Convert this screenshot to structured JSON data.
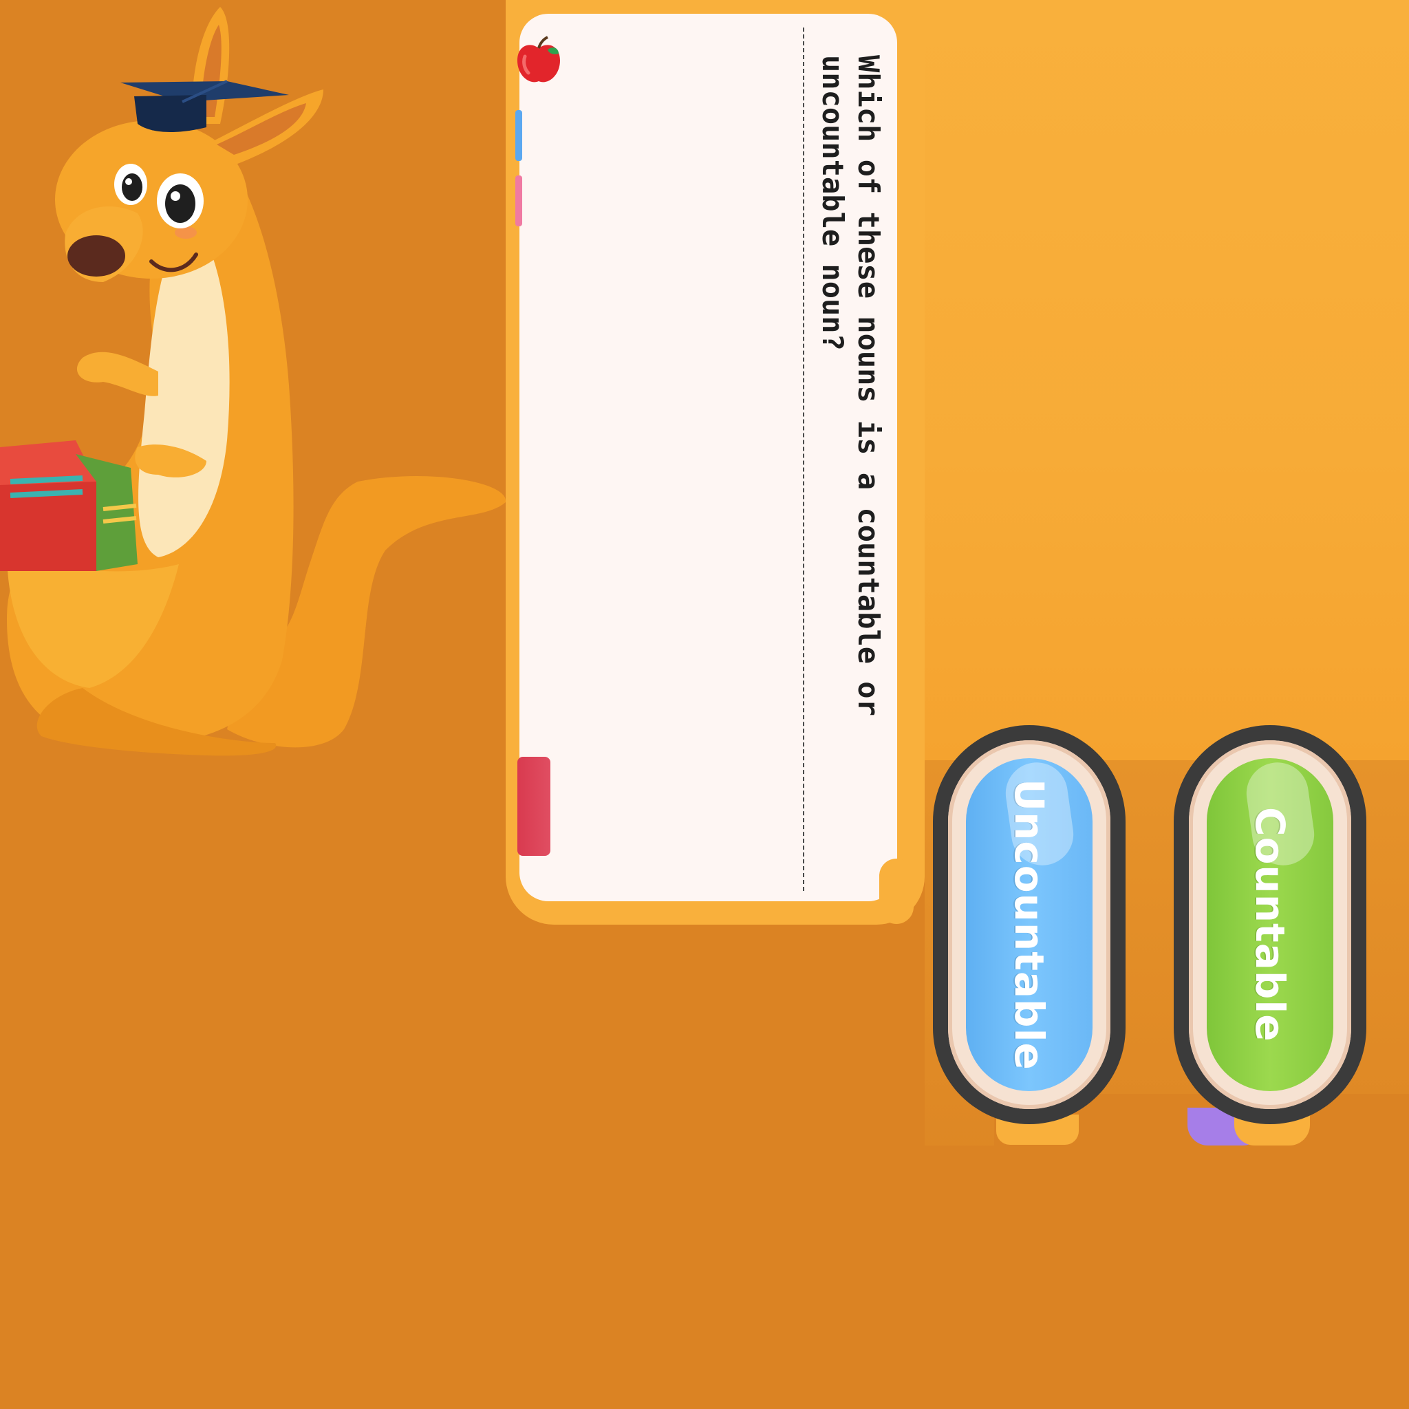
{
  "question": {
    "text": "Which of these nouns is a countable or uncountable noun?"
  },
  "answers": [
    {
      "label": "Uncountable",
      "color": "#7CC6FD"
    },
    {
      "label": "Countable",
      "color": "#9CD94E"
    }
  ],
  "colors": {
    "background": "#DB8323",
    "frame": "#F9B03C",
    "card": "#FEF6F3",
    "accent_blue_tab": "#5BA8F0",
    "accent_pink_tab": "#F07AA2",
    "accent_red_tab": "#D93A4F"
  },
  "icons": {
    "mascot": "kangaroo-with-graduation-cap-and-books",
    "card_decoration": "apple-icon"
  }
}
